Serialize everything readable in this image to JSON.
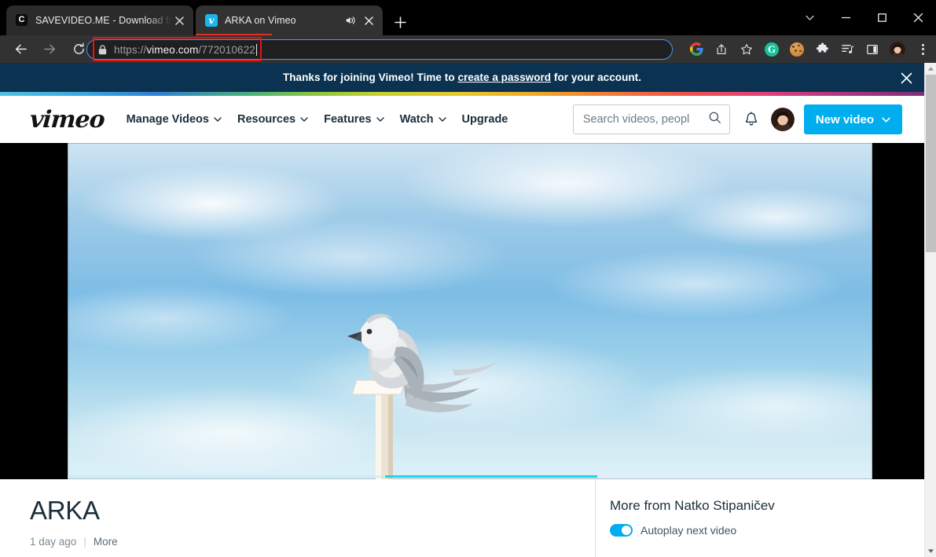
{
  "browser": {
    "tabs": [
      {
        "title": "SAVEVIDEO.ME - Download from",
        "favicon": "savevideo-favicon",
        "favicon_glyph": "C",
        "active": false
      },
      {
        "title": "ARKA on Vimeo",
        "favicon": "vimeo-favicon",
        "favicon_glyph": "v",
        "active": true,
        "audio_playing": true
      }
    ],
    "new_tab_label": "+",
    "window_controls": [
      "chevron-down",
      "minimize",
      "maximize",
      "close"
    ],
    "toolbar": {
      "back": "Back",
      "forward": "Forward",
      "reload": "Reload",
      "url_scheme": "https://",
      "url_domain": "vimeo.com",
      "url_path": "/772010622",
      "secure": true,
      "extensions": [
        "google-icon",
        "share-icon",
        "bookmark-star-icon",
        "grammarly-icon",
        "cookie-icon",
        "puzzle-extensions-icon",
        "reading-list-icon",
        "side-panel-icon"
      ],
      "grammarly_glyph": "G",
      "profile": "profile-avatar",
      "menu": "chrome-menu"
    },
    "url_highlight_color": "#ee1111"
  },
  "banner": {
    "text_before": "Thanks for joining Vimeo! Time to ",
    "link": "create a password",
    "text_after": " for your account.",
    "close_label": "Close",
    "background": "#0b3351"
  },
  "header": {
    "logo": "vimeo",
    "nav": [
      {
        "label": "Manage Videos",
        "has_dropdown": true
      },
      {
        "label": "Resources",
        "has_dropdown": true
      },
      {
        "label": "Features",
        "has_dropdown": true
      },
      {
        "label": "Watch",
        "has_dropdown": true
      },
      {
        "label": "Upgrade",
        "has_dropdown": false
      }
    ],
    "search": {
      "placeholder": "Search videos, peopl",
      "value": ""
    },
    "notifications": "bell-icon",
    "avatar": "user-avatar",
    "new_video_button": "New video",
    "accent_color": "#00adef"
  },
  "player": {
    "poster_description": "Gray and white bird perched on a white post against a blue cloudy sky",
    "progress_color": "#22d3ee",
    "letterbox_color": "#000000"
  },
  "video": {
    "title": "ARKA",
    "uploaded": "1 day ago",
    "more_label": "More",
    "separator": "|"
  },
  "sidebar": {
    "heading": "More from Natko Stipaničev",
    "autoplay_label": "Autoplay next video",
    "autoplay_on": true
  }
}
